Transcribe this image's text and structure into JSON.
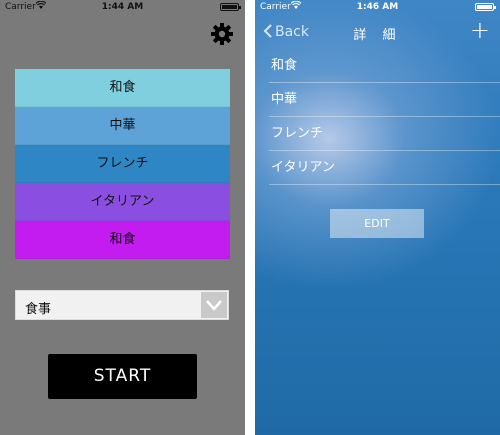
{
  "left_screen": {
    "status": {
      "carrier": "Carrier",
      "time": "1:44 AM"
    },
    "settings_icon": "gear-icon",
    "categories": [
      {
        "label": "和食",
        "color": "#7fcfdf"
      },
      {
        "label": "中華",
        "color": "#5ea3d8"
      },
      {
        "label": "フレンチ",
        "color": "#2f86c4"
      },
      {
        "label": "イタリアン",
        "color": "#8a4fe0"
      },
      {
        "label": "和食",
        "color": "#c21cf1"
      }
    ],
    "select": {
      "value": "食事",
      "icon": "chevron-down-icon"
    },
    "start_label": "START"
  },
  "right_screen": {
    "status": {
      "carrier": "Carrier",
      "time": "1:46 AM"
    },
    "nav": {
      "back_label": "Back",
      "title": "詳 細",
      "add_label": "+"
    },
    "items": [
      "和食",
      "中華",
      "フレンチ",
      "イタリアン"
    ],
    "edit_label": "EDIT"
  }
}
